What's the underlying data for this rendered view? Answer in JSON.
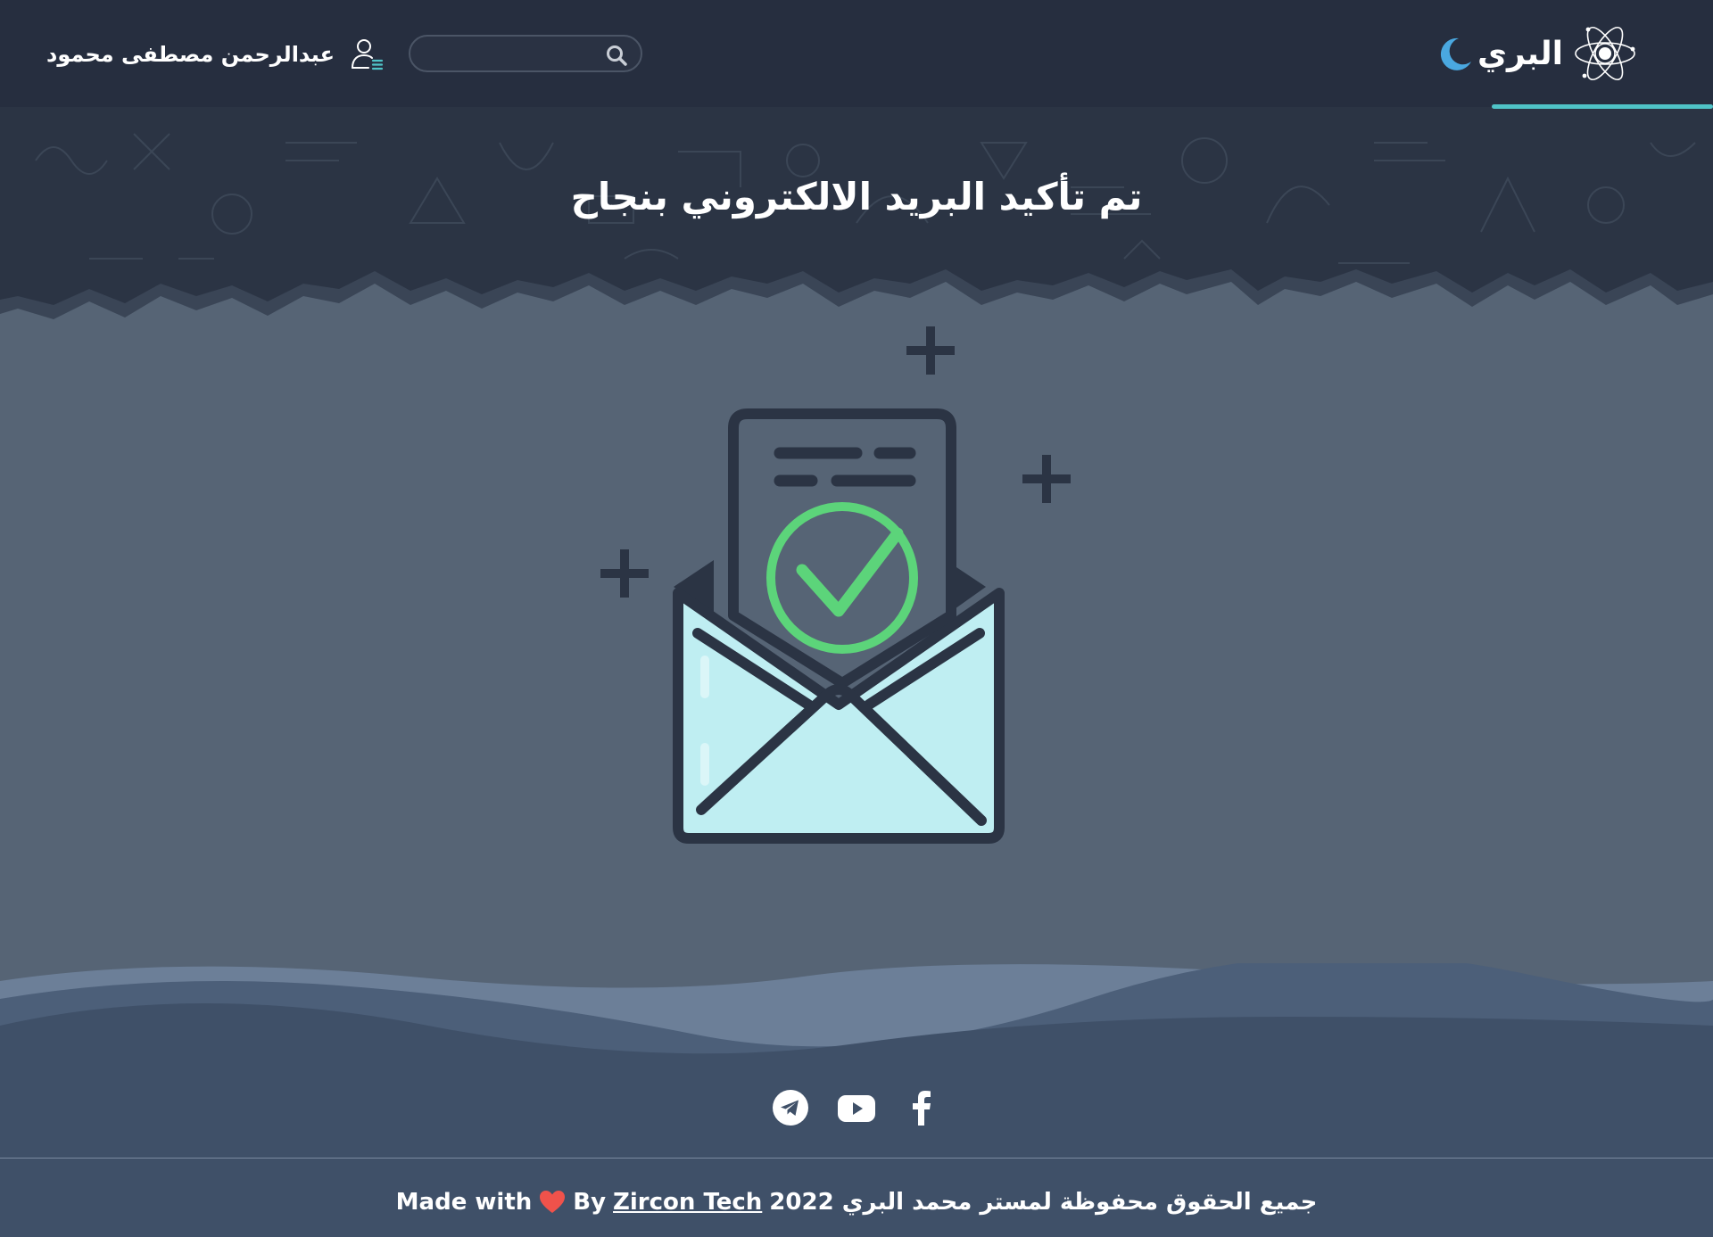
{
  "navbar": {
    "brand_name": "البري",
    "logo_icon": "atom-logo-icon",
    "theme_toggle_icon": "moon-icon",
    "search": {
      "placeholder": "",
      "value": "",
      "icon": "search-icon"
    },
    "user": {
      "name": "عبدالرحمن مصطفى محمود",
      "icon": "user-menu-icon"
    }
  },
  "hero": {
    "title": "تم تأكيد البريد الالكتروني بنجاح"
  },
  "illustration": {
    "icon": "email-verified-icon"
  },
  "footer": {
    "social": [
      {
        "name": "telegram",
        "icon": "telegram-icon"
      },
      {
        "name": "youtube",
        "icon": "youtube-icon"
      },
      {
        "name": "facebook",
        "icon": "facebook-icon"
      }
    ],
    "copyright": {
      "made_with": "Made with",
      "by": "By",
      "company": "Zircon Tech",
      "rights": "جميع الحقوق محفوظة لمستر محمد البري 2022"
    }
  },
  "colors": {
    "navbar_bg": "#262e3f",
    "page_bg": "#566475",
    "accent": "#4fc3c7",
    "moon": "#4aa8e0",
    "check_green": "#5cd47a",
    "envelope_fill": "#bfeef2",
    "heart": "#f0524b",
    "footer_bg": "#3f5068"
  }
}
